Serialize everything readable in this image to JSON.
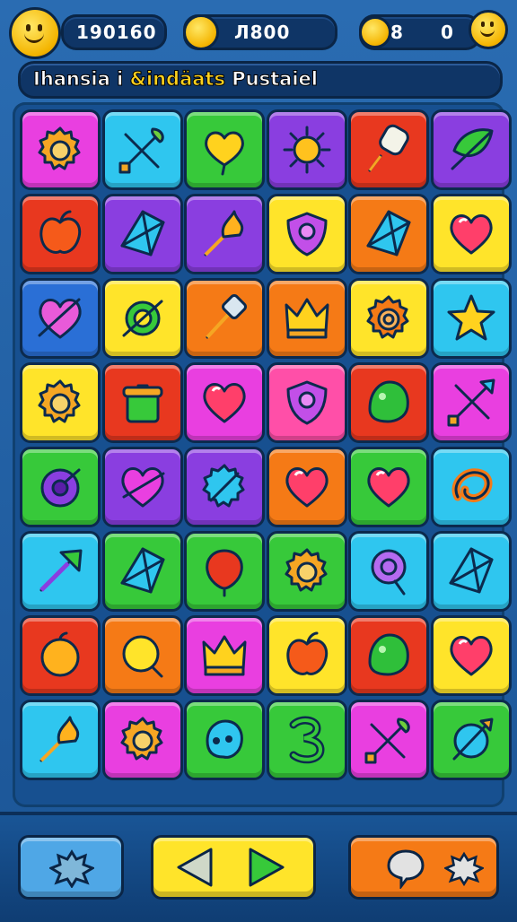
{
  "hud": {
    "score": "190160",
    "coins": "Л800",
    "moves_a": "8",
    "moves_b": "0"
  },
  "title": {
    "part1": "Ihansia i ",
    "part2": "&indäats",
    "part3": " Pustaiel"
  },
  "colors": {
    "magenta": "#e93fe0",
    "cyan": "#2fc6ef",
    "green": "#37c93a",
    "purple": "#8a3ee0",
    "red": "#e8381f",
    "yellow": "#ffe42a",
    "orange": "#f57a16",
    "blue": "#2a6fd6",
    "pink": "#ff4fa8"
  },
  "board": {
    "rows": [
      [
        {
          "bg": "magenta",
          "icon": "gear-icon"
        },
        {
          "bg": "cyan",
          "icon": "crossed-tools-icon"
        },
        {
          "bg": "green",
          "icon": "heart-balloon-icon"
        },
        {
          "bg": "purple",
          "icon": "sun-icon"
        },
        {
          "bg": "red",
          "icon": "ice-pop-icon"
        },
        {
          "bg": "purple",
          "icon": "leaf-sword-icon"
        }
      ],
      [
        {
          "bg": "red",
          "icon": "apple-icon"
        },
        {
          "bg": "purple",
          "icon": "kite-icon"
        },
        {
          "bg": "purple",
          "icon": "torch-icon"
        },
        {
          "bg": "yellow",
          "icon": "shield-icon"
        },
        {
          "bg": "orange",
          "icon": "kite-icon"
        },
        {
          "bg": "yellow",
          "icon": "heart-icon"
        }
      ],
      [
        {
          "bg": "blue",
          "icon": "arrow-heart-icon"
        },
        {
          "bg": "yellow",
          "icon": "swirl-ring-icon"
        },
        {
          "bg": "orange",
          "icon": "hammer-icon"
        },
        {
          "bg": "orange",
          "icon": "crown-icon"
        },
        {
          "bg": "yellow",
          "icon": "spiral-gear-icon"
        },
        {
          "bg": "cyan",
          "icon": "star-icon"
        }
      ],
      [
        {
          "bg": "yellow",
          "icon": "gear-icon"
        },
        {
          "bg": "red",
          "icon": "pot-icon"
        },
        {
          "bg": "magenta",
          "icon": "heart-icon"
        },
        {
          "bg": "pink",
          "icon": "shield-icon"
        },
        {
          "bg": "red",
          "icon": "slime-icon"
        },
        {
          "bg": "magenta",
          "icon": "crossed-swords-icon"
        }
      ],
      [
        {
          "bg": "green",
          "icon": "orb-icon"
        },
        {
          "bg": "purple",
          "icon": "heart-arrow-icon"
        },
        {
          "bg": "purple",
          "icon": "gear-orb-icon"
        },
        {
          "bg": "orange",
          "icon": "heart-icon"
        },
        {
          "bg": "green",
          "icon": "heart-icon"
        },
        {
          "bg": "cyan",
          "icon": "ring-icon"
        }
      ],
      [
        {
          "bg": "cyan",
          "icon": "arrow-icon"
        },
        {
          "bg": "green",
          "icon": "kite-icon"
        },
        {
          "bg": "green",
          "icon": "balloon-icon"
        },
        {
          "bg": "green",
          "icon": "gear-icon"
        },
        {
          "bg": "cyan",
          "icon": "lollipop-icon"
        },
        {
          "bg": "cyan",
          "icon": "kite-icon"
        }
      ],
      [
        {
          "bg": "red",
          "icon": "fruit-icon"
        },
        {
          "bg": "orange",
          "icon": "magnifier-icon"
        },
        {
          "bg": "magenta",
          "icon": "crown-icon"
        },
        {
          "bg": "yellow",
          "icon": "apple-icon"
        },
        {
          "bg": "red",
          "icon": "slime-icon"
        },
        {
          "bg": "yellow",
          "icon": "heart-icon"
        }
      ],
      [
        {
          "bg": "cyan",
          "icon": "torch-icon"
        },
        {
          "bg": "magenta",
          "icon": "gear-icon"
        },
        {
          "bg": "green",
          "icon": "blob-icon"
        },
        {
          "bg": "green",
          "icon": "number-three-icon"
        },
        {
          "bg": "magenta",
          "icon": "crossed-tools-icon"
        },
        {
          "bg": "green",
          "icon": "shield-arrow-icon"
        }
      ]
    ]
  },
  "bottom": {
    "left_button_icon": "splat-icon",
    "center_button_icons": [
      "triangle-left-icon",
      "triangle-right-icon"
    ],
    "right_button_icons": [
      "chat-bubble-icon",
      "splat-icon"
    ]
  }
}
